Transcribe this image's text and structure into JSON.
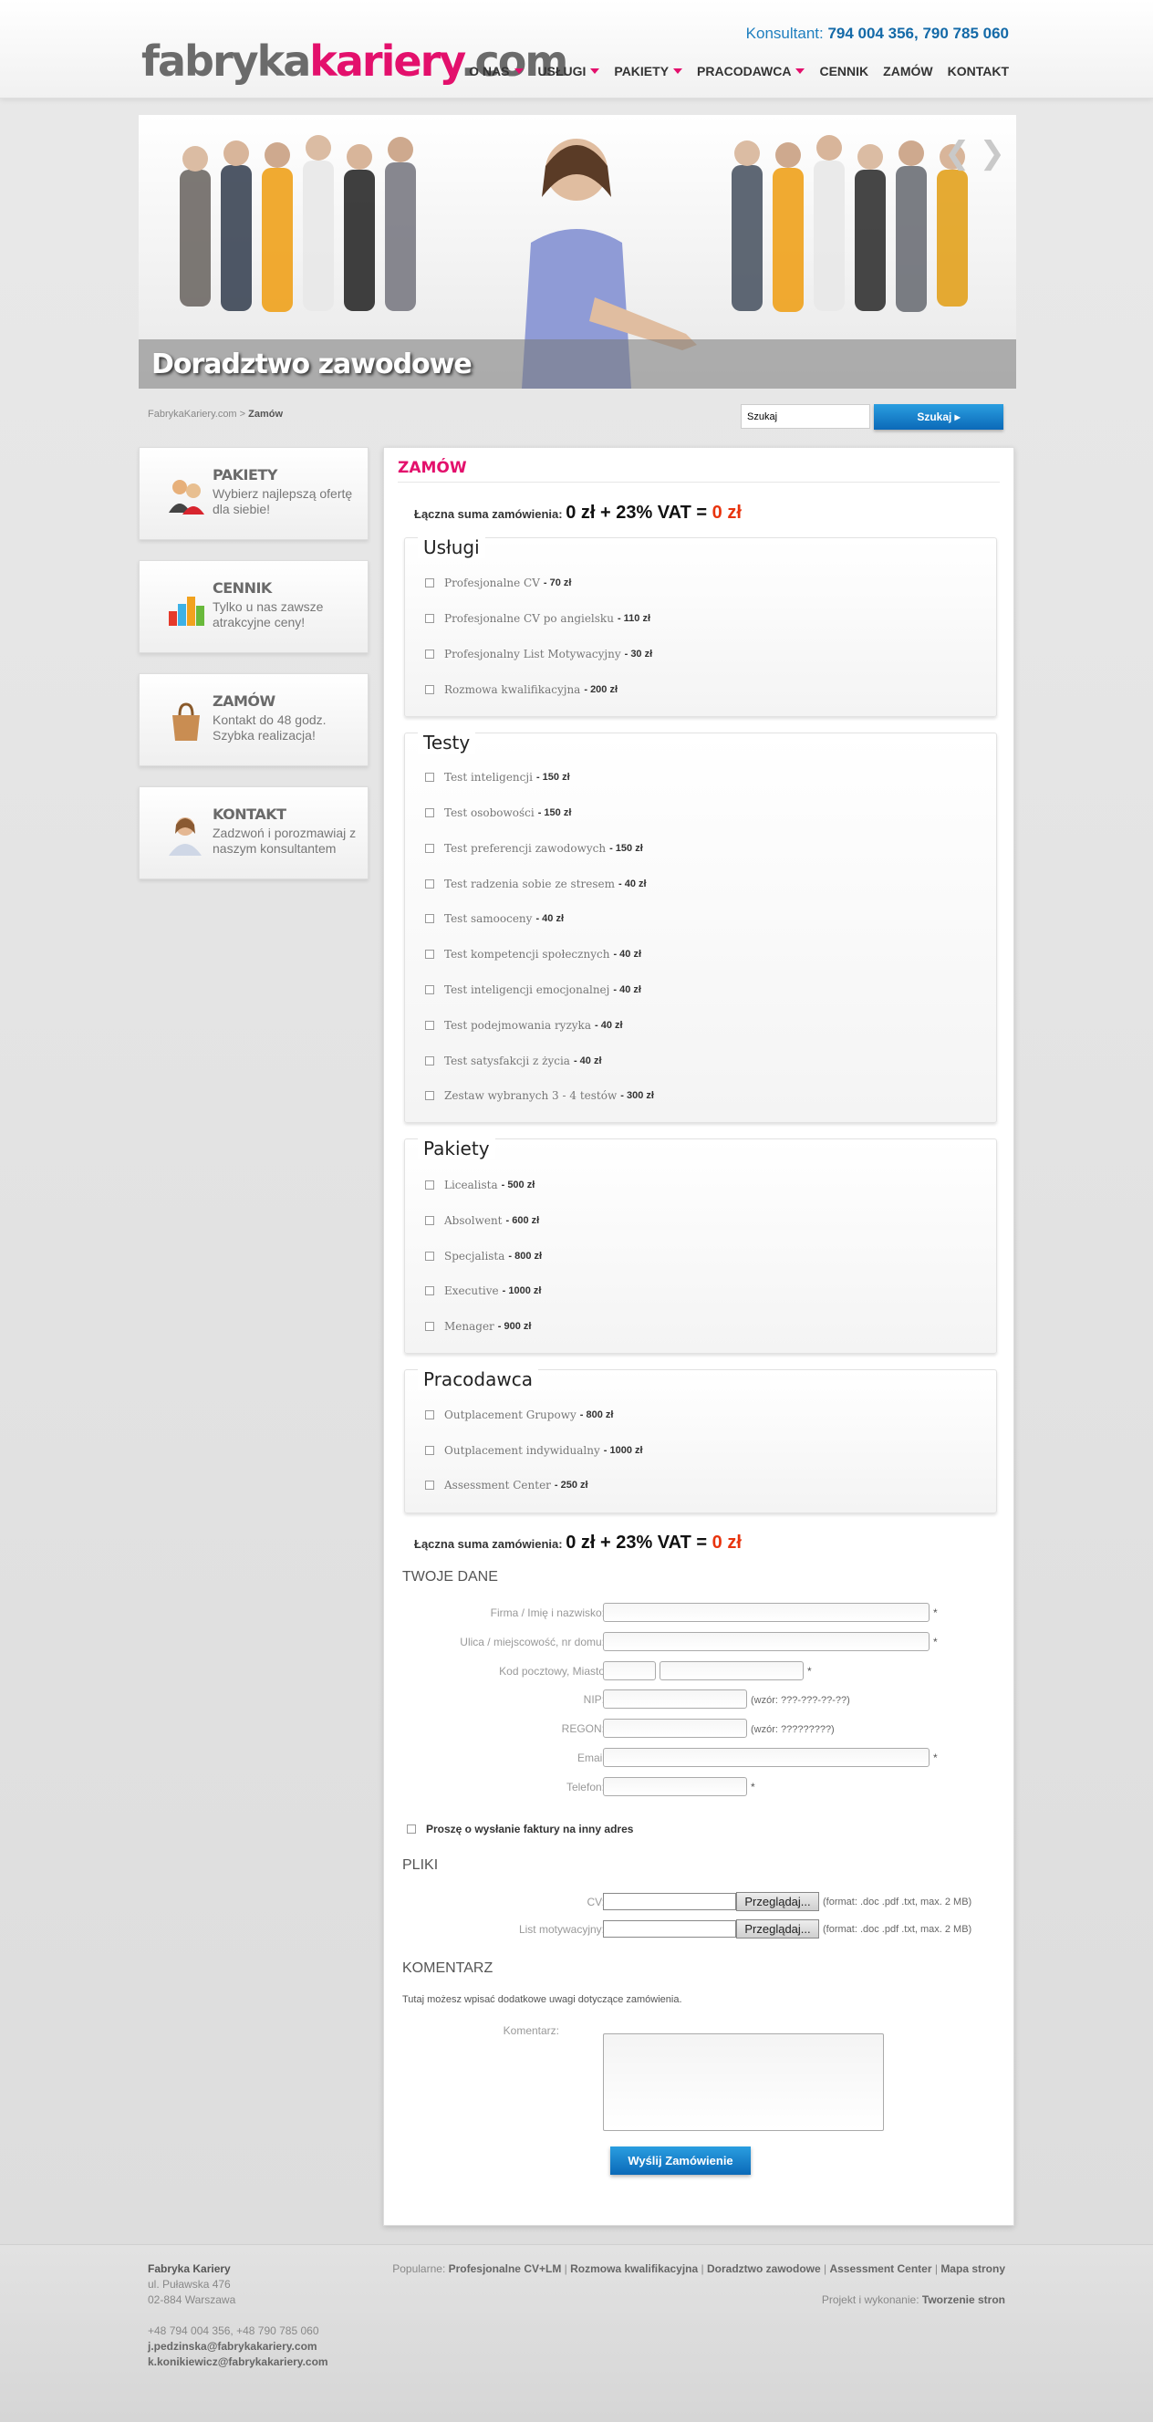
{
  "header": {
    "logo": {
      "part1": "fabryka",
      "part2": "kariery",
      "part3": ".com"
    },
    "consultant_label": "Konsultant:",
    "consultant_phones": "794 004 356, 790 785 060",
    "nav": [
      "O NAS",
      "USŁUGI",
      "PAKIETY",
      "PRACODAWCA",
      "CENNIK",
      "ZAMÓW",
      "KONTAKT"
    ]
  },
  "banner": {
    "caption": "Doradztwo zawodowe"
  },
  "breadcrumb": {
    "home": "FabrykaKariery.com",
    "sep": " > ",
    "current": "Zamów"
  },
  "search": {
    "placeholder": "Szukaj",
    "button": "Szukaj ▸"
  },
  "sidebar": [
    {
      "title": "PAKIETY",
      "text": "Wybierz najlepszą ofertę dla siebie!",
      "icon": "people-icon"
    },
    {
      "title": "CENNIK",
      "text": "Tylko u nas zawsze atrakcyjne ceny!",
      "icon": "bar-chart-icon"
    },
    {
      "title": "ZAMÓW",
      "text": "Kontakt do 48 godz. Szybka realizacja!",
      "icon": "shopping-bag-icon"
    },
    {
      "title": "KONTAKT",
      "text": "Zadzwoń i porozmawiaj z naszym konsultantem",
      "icon": "consultant-icon"
    }
  ],
  "main": {
    "title": "ZAMÓW",
    "total": {
      "label": "Łączna suma zamówienia:",
      "value": "0 zł + 23% VAT = ",
      "sum": "0 zł"
    },
    "sections": [
      {
        "legend": "Usługi",
        "items": [
          {
            "name": "Profesjonalne CV",
            "price": "- 70 zł"
          },
          {
            "name": "Profesjonalne CV po angielsku",
            "price": "- 110 zł"
          },
          {
            "name": "Profesjonalny List Motywacyjny",
            "price": "- 30 zł"
          },
          {
            "name": "Rozmowa kwalifikacyjna",
            "price": "- 200 zł"
          }
        ]
      },
      {
        "legend": "Testy",
        "items": [
          {
            "name": "Test inteligencji",
            "price": "- 150 zł"
          },
          {
            "name": "Test osobowości",
            "price": "- 150 zł"
          },
          {
            "name": "Test preferencji zawodowych",
            "price": "- 150 zł"
          },
          {
            "name": "Test radzenia sobie ze stresem",
            "price": "- 40 zł"
          },
          {
            "name": "Test samooceny",
            "price": "- 40 zł"
          },
          {
            "name": "Test kompetencji społecznych",
            "price": "- 40 zł"
          },
          {
            "name": "Test inteligencji emocjonalnej",
            "price": "- 40 zł"
          },
          {
            "name": "Test podejmowania ryzyka",
            "price": "- 40 zł"
          },
          {
            "name": "Test satysfakcji z życia",
            "price": "- 40 zł"
          },
          {
            "name": "Zestaw wybranych 3 - 4 testów",
            "price": "- 300 zł"
          }
        ]
      },
      {
        "legend": "Pakiety",
        "items": [
          {
            "name": "Licealista",
            "price": "- 500 zł"
          },
          {
            "name": "Absolwent",
            "price": "- 600 zł"
          },
          {
            "name": "Specjalista",
            "price": "- 800 zł"
          },
          {
            "name": "Executive",
            "price": "- 1000 zł"
          },
          {
            "name": "Menager",
            "price": "- 900 zł"
          }
        ]
      },
      {
        "legend": "Pracodawca",
        "items": [
          {
            "name": "Outplacement Grupowy",
            "price": "- 800 zł"
          },
          {
            "name": "Outplacement indywidualny",
            "price": "- 1000 zł"
          },
          {
            "name": "Assessment Center",
            "price": "- 250 zł"
          }
        ]
      }
    ],
    "your_data": {
      "heading": "TWOJE DANE",
      "fields": {
        "company": "Firma / Imię i nazwisko:",
        "street": "Ulica / miejscowość, nr domu:",
        "postal": "Kod pocztowy, Miasto",
        "nip": "NIP:",
        "nip_hint": "(wzór: ???-???-??-??)",
        "regon": "REGON:",
        "regon_hint": "(wzór: ?????????)",
        "email": "Email",
        "phone": "Telefon:"
      },
      "required_mark": "*",
      "invoice_checkbox": "Proszę o wysłanie faktury na inny adres"
    },
    "files": {
      "heading": "PLIKI",
      "cv_label": "CV:",
      "letter_label": "List motywacyjny:",
      "browse": "Przeglądaj...",
      "format_hint": "(format: .doc .pdf .txt, max. 2 MB)"
    },
    "comment": {
      "heading": "KOMENTARZ",
      "note": "Tutaj możesz wpisać dodatkowe uwagi dotyczące zamówienia.",
      "label": "Komentarz:"
    },
    "submit": "Wyślij Zamówienie"
  },
  "footer": {
    "company": "Fabryka Kariery",
    "address1": "ul. Puławska 476",
    "address2": "02-884 Warszawa",
    "phones": "+48 794 004 356, +48 790 785 060",
    "email1": "j.pedzinska@fabrykakariery.com",
    "email2": "k.konikiewicz@fabrykakariery.com",
    "popular_label": "Popularne:",
    "popular_links": [
      "Profesjonalne CV+LM",
      "Rozmowa kwalifikacyjna",
      "Doradztwo zawodowe",
      "Assessment Center",
      "Mapa strony"
    ],
    "credit_label": "Projekt i wykonanie:",
    "credit_link": "Tworzenie stron"
  }
}
